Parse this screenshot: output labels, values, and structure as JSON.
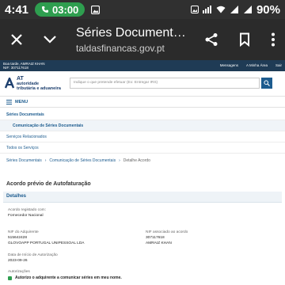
{
  "status_bar": {
    "time": "4:41",
    "call_timer": "03:00",
    "battery": "90%"
  },
  "browser": {
    "title": "Séries Document…",
    "url": "taldasfinancas.gov.pt"
  },
  "site": {
    "user_line1": "Boa tarde, AMRAIZ KHAN",
    "user_line2": "NIF: 307117618",
    "top_links": [
      "Mensagens",
      "A Minha Área",
      "Sair"
    ],
    "logo_line1": "AT",
    "logo_line2": "autoridade",
    "logo_line3": "tributária e aduaneira",
    "search_placeholder": "Indique o que pretende efetuar (Ex: Entregar IRS)",
    "menu_label": "MENU"
  },
  "nav": {
    "items": [
      "Séries Documentais",
      "Comunicação de Séries Documentais",
      "Serviços Relacionados",
      "Todos os Serviços"
    ]
  },
  "breadcrumb": {
    "items": [
      "Séries Documentais",
      "Comunicação de Séries Documentais",
      "Detalhe Acordo"
    ]
  },
  "page": {
    "title": "Acordo prévio de Autofaturação",
    "panel_title": "Detalhes",
    "fields": {
      "registered_label": "Acordo registado com:",
      "registered_value": "Fornecedor Nacional",
      "nif_adq_label": "NIF do Adquirente",
      "nif_adq_value": "515642428",
      "nif_adq_name": "GLOVOAPP PORTUGAL UNIPESSOAL LDA",
      "nif_assoc_label": "NIF associado ao acordo",
      "nif_assoc_value": "307117618",
      "nif_assoc_name": "AMRAIZ KHAN",
      "date_label": "Data de Início de Autorização",
      "date_value": "2023-09-26",
      "authorizations_label": "Autorizações",
      "authorization_text": "Autorizo o adquirente a comunicar séries em meu nome."
    }
  }
}
